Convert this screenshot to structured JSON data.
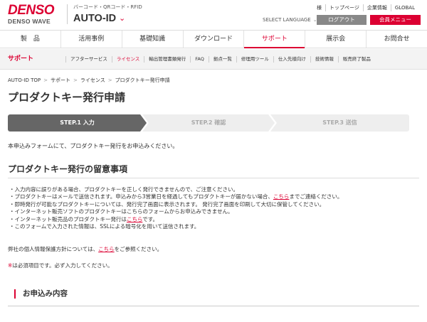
{
  "header": {
    "brand_denso": "DENSO",
    "brand_wave": "DENSO WAVE",
    "tagline": "バーコード・QRコード・RFID",
    "product_name": "AUTO-ID",
    "product_chevron": "⌄",
    "util_links": [
      "様",
      "トップページ",
      "企業情報",
      "GLOBAL"
    ],
    "language_select": "SELECT LANGUAGE",
    "language_chevron": "⌄",
    "login_button": "ログアウト",
    "member_menu_button": "会員メニュー",
    "brand_color": "#dc0032"
  },
  "global_nav": {
    "items": [
      "製　品",
      "活用事例",
      "基礎知識",
      "ダウンロード",
      "サポート",
      "展示会",
      "お問合せ"
    ],
    "active_index": 4
  },
  "sub_nav": {
    "title": "サポート",
    "items": [
      "アフターサービス",
      "ライセンス",
      "輸出管理書類発行",
      "FAQ",
      "拠点一覧",
      "修理用ツール",
      "仕入先様向け",
      "技術情報",
      "販売終了製品"
    ],
    "active_index": 1
  },
  "breadcrumb": [
    "AUTO-ID TOP",
    "サポート",
    "ライセンス",
    "プロダクトキー発行申請"
  ],
  "breadcrumb_separator": ">",
  "page_title": "プロダクトキー発行申請",
  "steps": [
    "STEP.1 入力",
    "STEP.2 確認",
    "STEP.3 送信"
  ],
  "active_step": 0,
  "intro": "本申込みフォームにて、プロダクトキー発行をお申込みください。",
  "notes_section": {
    "title": "プロダクトキー発行の留意事項",
    "items": [
      {
        "text": "・入力内容に誤りがある場合、プロダクトキーを正しく発行できませんので、ご注意ください。",
        "link": "",
        "suffix": ""
      },
      {
        "text": "・プロダクトキーはメールで送信されます。申込みから3営業日を経過してもプロダクトキーが届かない場合、",
        "link": "こちら",
        "suffix": "までご連絡ください。"
      },
      {
        "text": "・即時発行が可能なプロダクトキーについては、発行完了画面に表示されます。 発行完了画面を印刷して大切に保管してください。",
        "link": "",
        "suffix": ""
      },
      {
        "text": "・インターネット販売ソフトのプロダクトキーはこちらのフォームからお申込みできません。",
        "link": "",
        "suffix": ""
      },
      {
        "text": "・インターネット販売品のプロダクトキー発行は",
        "link": "こちら",
        "suffix": "です。"
      },
      {
        "text": "・このフォームで入力された情報は、SSLによる暗号化を用いて送信されます。",
        "link": "",
        "suffix": ""
      }
    ]
  },
  "privacy": {
    "text": "弊社の個人情報保護方針については、",
    "link": "こちら",
    "suffix": "をご参照ください。"
  },
  "required_note": {
    "mark": "※",
    "text": "は必須項目です。必ず入力してください。"
  },
  "form_heading": "お申込み内容"
}
